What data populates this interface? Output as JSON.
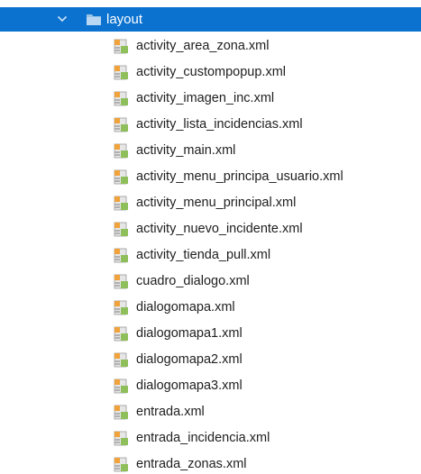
{
  "folder": {
    "name": "layout",
    "expanded": true,
    "chevron_icon": "chevron-down-icon",
    "folder_icon": "folder-icon",
    "highlight_color": "#0b72d0"
  },
  "files": [
    {
      "label": "activity_area_zona.xml",
      "icon": "layout-xml-file-icon"
    },
    {
      "label": "activity_custompopup.xml",
      "icon": "layout-xml-file-icon"
    },
    {
      "label": "activity_imagen_inc.xml",
      "icon": "layout-xml-file-icon"
    },
    {
      "label": "activity_lista_incidencias.xml",
      "icon": "layout-xml-file-icon"
    },
    {
      "label": "activity_main.xml",
      "icon": "layout-xml-file-icon"
    },
    {
      "label": "activity_menu_principa_usuario.xml",
      "icon": "layout-xml-file-icon"
    },
    {
      "label": "activity_menu_principal.xml",
      "icon": "layout-xml-file-icon"
    },
    {
      "label": "activity_nuevo_incidente.xml",
      "icon": "layout-xml-file-icon"
    },
    {
      "label": "activity_tienda_pull.xml",
      "icon": "layout-xml-file-icon"
    },
    {
      "label": "cuadro_dialogo.xml",
      "icon": "layout-xml-file-icon"
    },
    {
      "label": "dialogomapa.xml",
      "icon": "layout-xml-file-icon"
    },
    {
      "label": "dialogomapa1.xml",
      "icon": "layout-xml-file-icon"
    },
    {
      "label": "dialogomapa2.xml",
      "icon": "layout-xml-file-icon"
    },
    {
      "label": "dialogomapa3.xml",
      "icon": "layout-xml-file-icon"
    },
    {
      "label": "entrada.xml",
      "icon": "layout-xml-file-icon"
    },
    {
      "label": "entrada_incidencia.xml",
      "icon": "layout-xml-file-icon"
    },
    {
      "label": "entrada_zonas.xml",
      "icon": "layout-xml-file-icon"
    }
  ]
}
